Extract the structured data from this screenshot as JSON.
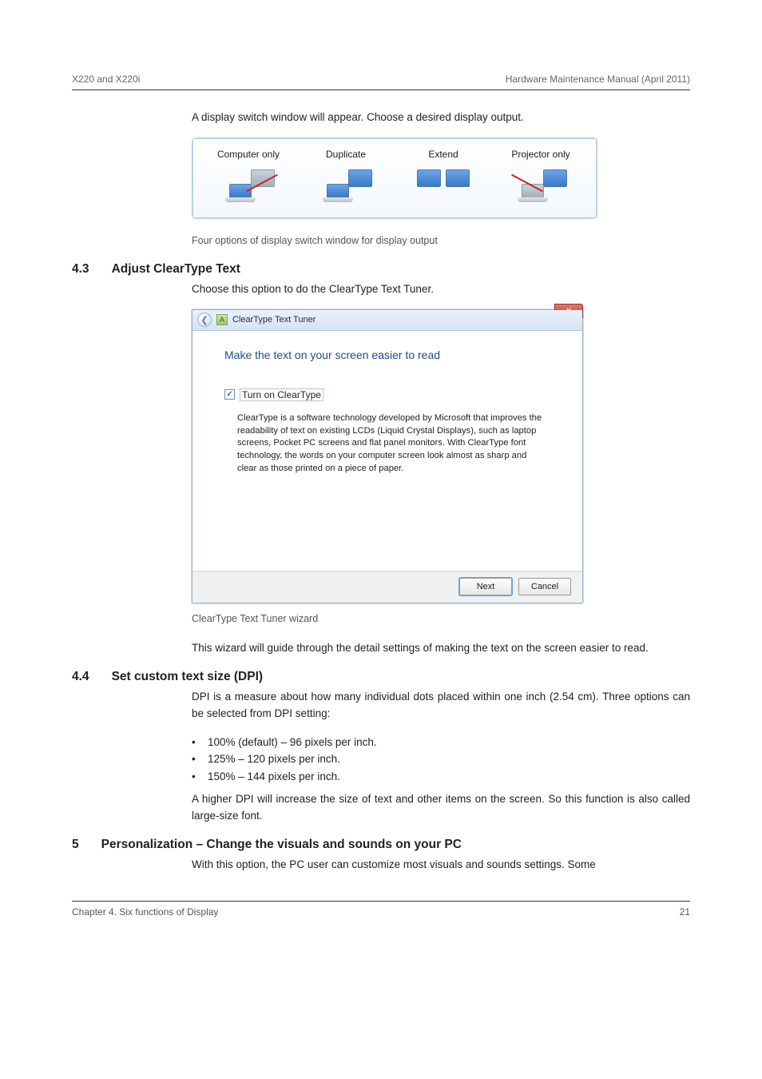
{
  "header": {
    "left": "X220 and X220i",
    "right": "Hardware Maintenance Manual (April 2011)"
  },
  "intro_para": "A display switch window will appear. Choose a desired display output.",
  "projector": {
    "options": [
      "Computer only",
      "Duplicate",
      "Extend",
      "Projector only"
    ],
    "caption": "Four options of display switch window for display output"
  },
  "section_adjust": {
    "num": "4.3",
    "title": "Adjust ClearType Text",
    "body1": "Choose this option to do the ClearType Text Tuner.",
    "body2": "This wizard will guide through the detail settings of making the text on the screen easier to read."
  },
  "cleartype": {
    "window_title": "ClearType Text Tuner",
    "close": "x",
    "heading": "Make the text on your screen easier to read",
    "checkbox": "Turn on ClearType",
    "checked": "✓",
    "desc": "ClearType is a software technology developed by Microsoft that improves the readability of text on existing LCDs (Liquid Crystal Displays), such as laptop screens, Pocket PC screens and flat panel monitors. With ClearType font technology, the words on your computer screen look almost as sharp and clear as those printed on a piece of paper.",
    "next": "Next",
    "cancel": "Cancel",
    "caption": "ClearType Text Tuner wizard"
  },
  "section_icons": {
    "num": "4.4",
    "title": "Set custom text size (DPI)",
    "body": "DPI is a measure about how many individual dots placed within one inch (2.54 cm). Three options can be selected from DPI setting:",
    "opts": [
      "100% (default) – 96 pixels per inch.",
      "125% – 120 pixels per inch.",
      "150% – 144 pixels per inch."
    ],
    "body2": "A higher DPI will increase the size of text and other items on the screen. So this function is also called large-size font."
  },
  "section_pc": {
    "num": "5",
    "title": "Personalization – Change the visuals and sounds on your PC",
    "body": "With this option, the PC user can customize most visuals and sounds settings. Some"
  },
  "footer": {
    "left": "Chapter 4. Six functions of Display",
    "right": "21"
  }
}
